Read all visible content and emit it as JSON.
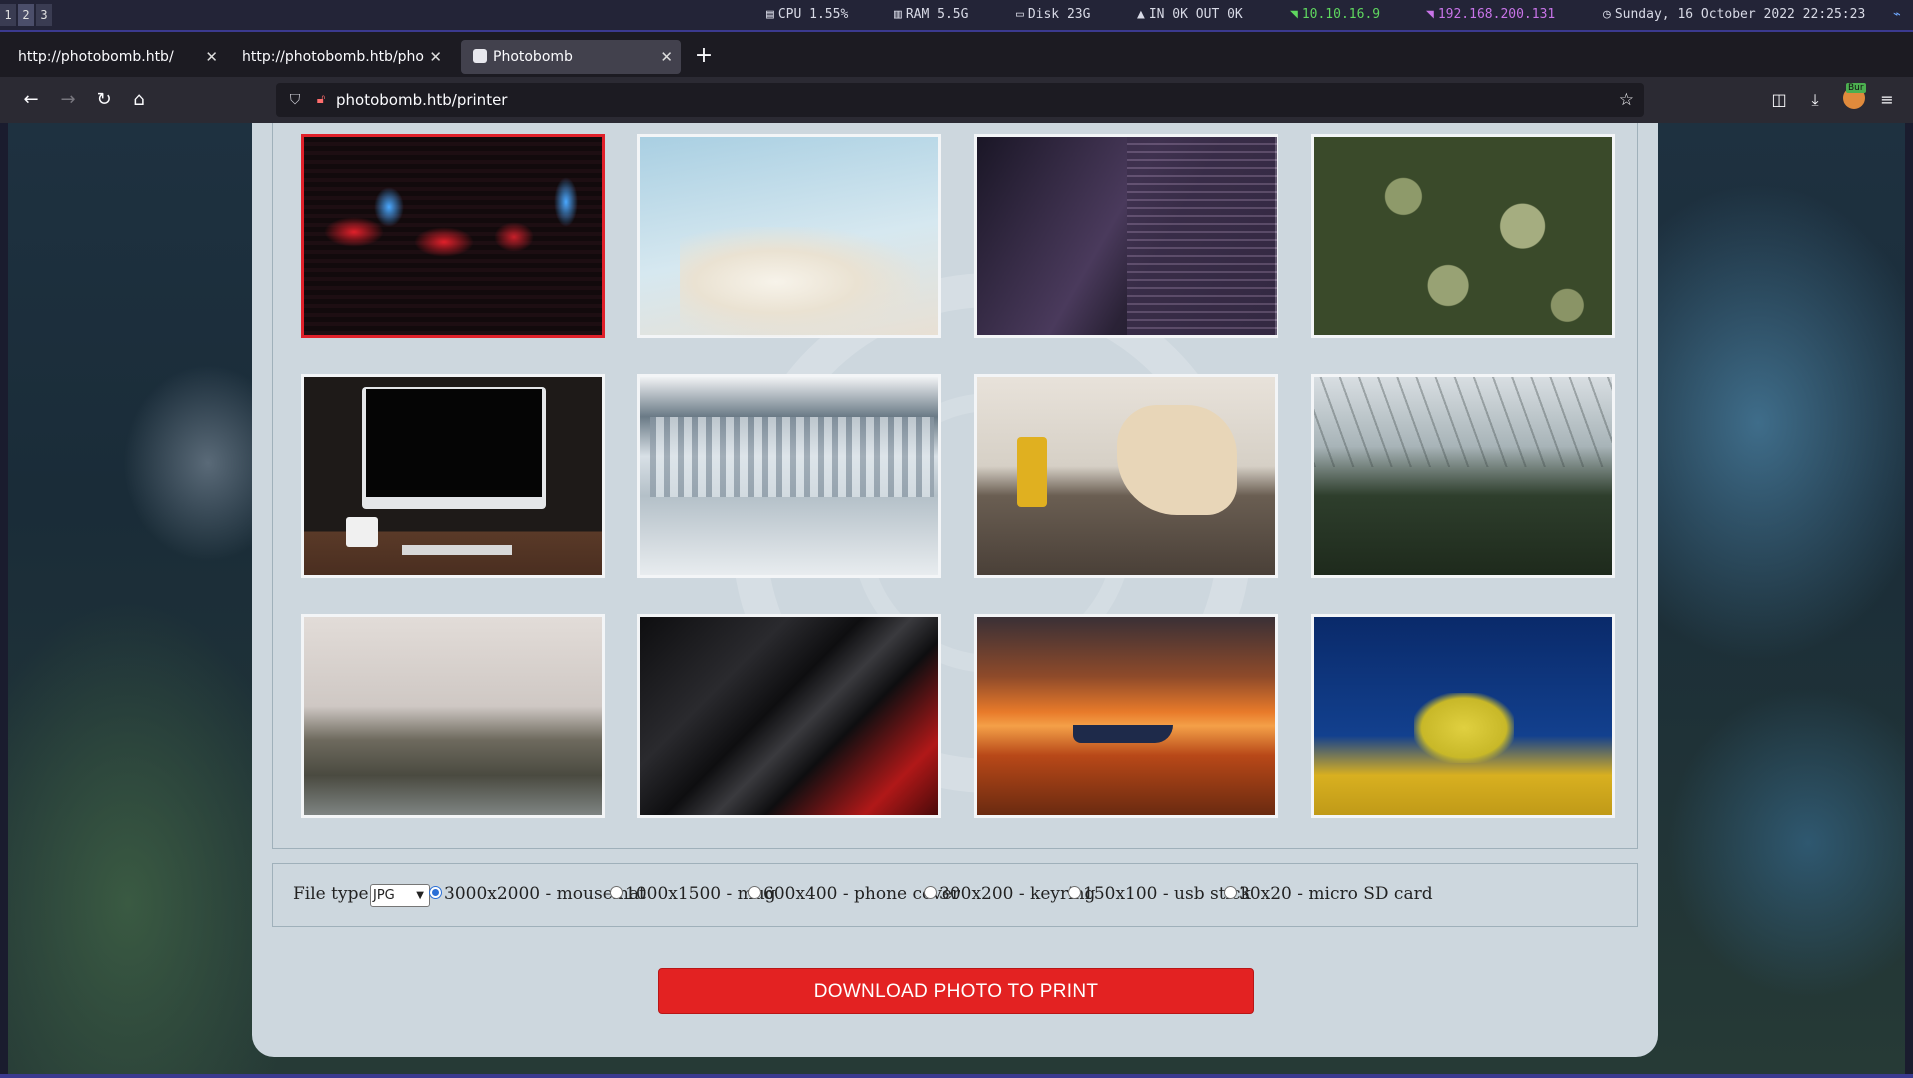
{
  "system_bar": {
    "workspaces": [
      "1",
      "2",
      "3"
    ],
    "cpu": "CPU 1.55%",
    "ram": "RAM 5.5G",
    "disk": "Disk 23G",
    "net": "IN 0K OUT 0K",
    "ip_local": "10.10.16.9",
    "ip_vpn": "192.168.200.131",
    "datetime": "Sunday, 16 October 2022 22:25:23",
    "colors": {
      "ip_local": "#5fd75f",
      "ip_vpn": "#c874e8"
    }
  },
  "browser": {
    "tabs": [
      {
        "title": "http://photobomb.htb/"
      },
      {
        "title": "http://photobomb.htb/photo"
      },
      {
        "title": "Photobomb"
      }
    ],
    "url": "photobomb.htb/printer",
    "burp_badge": "Bur"
  },
  "page": {
    "photos": [
      {
        "name": "dark-red-blinds"
      },
      {
        "name": "white-magnolia"
      },
      {
        "name": "purple-skyscrapers"
      },
      {
        "name": "green-succulents"
      },
      {
        "name": "desk-computer"
      },
      {
        "name": "frozen-waterfall"
      },
      {
        "name": "workshop-guitar-body"
      },
      {
        "name": "glasshouse-ferns"
      },
      {
        "name": "misty-coastline"
      },
      {
        "name": "abstract-red-black"
      },
      {
        "name": "boat-sunset"
      },
      {
        "name": "yellow-tree-blue-sky"
      }
    ],
    "selected_photo_index": 0,
    "file_type_label": "File type",
    "file_type_value": "JPG",
    "sizes": [
      {
        "label": "3000x2000 - mousemat",
        "checked": true
      },
      {
        "label": "1000x1500 - mug",
        "checked": false
      },
      {
        "label": "600x400 - phone cover",
        "checked": false
      },
      {
        "label": "300x200 - keyring",
        "checked": false
      },
      {
        "label": "150x100 - usb stick",
        "checked": false
      },
      {
        "label": "30x20 - micro SD card",
        "checked": false
      }
    ],
    "download_label": "DOWNLOAD PHOTO TO PRINT",
    "accent_color": "#e32222"
  }
}
